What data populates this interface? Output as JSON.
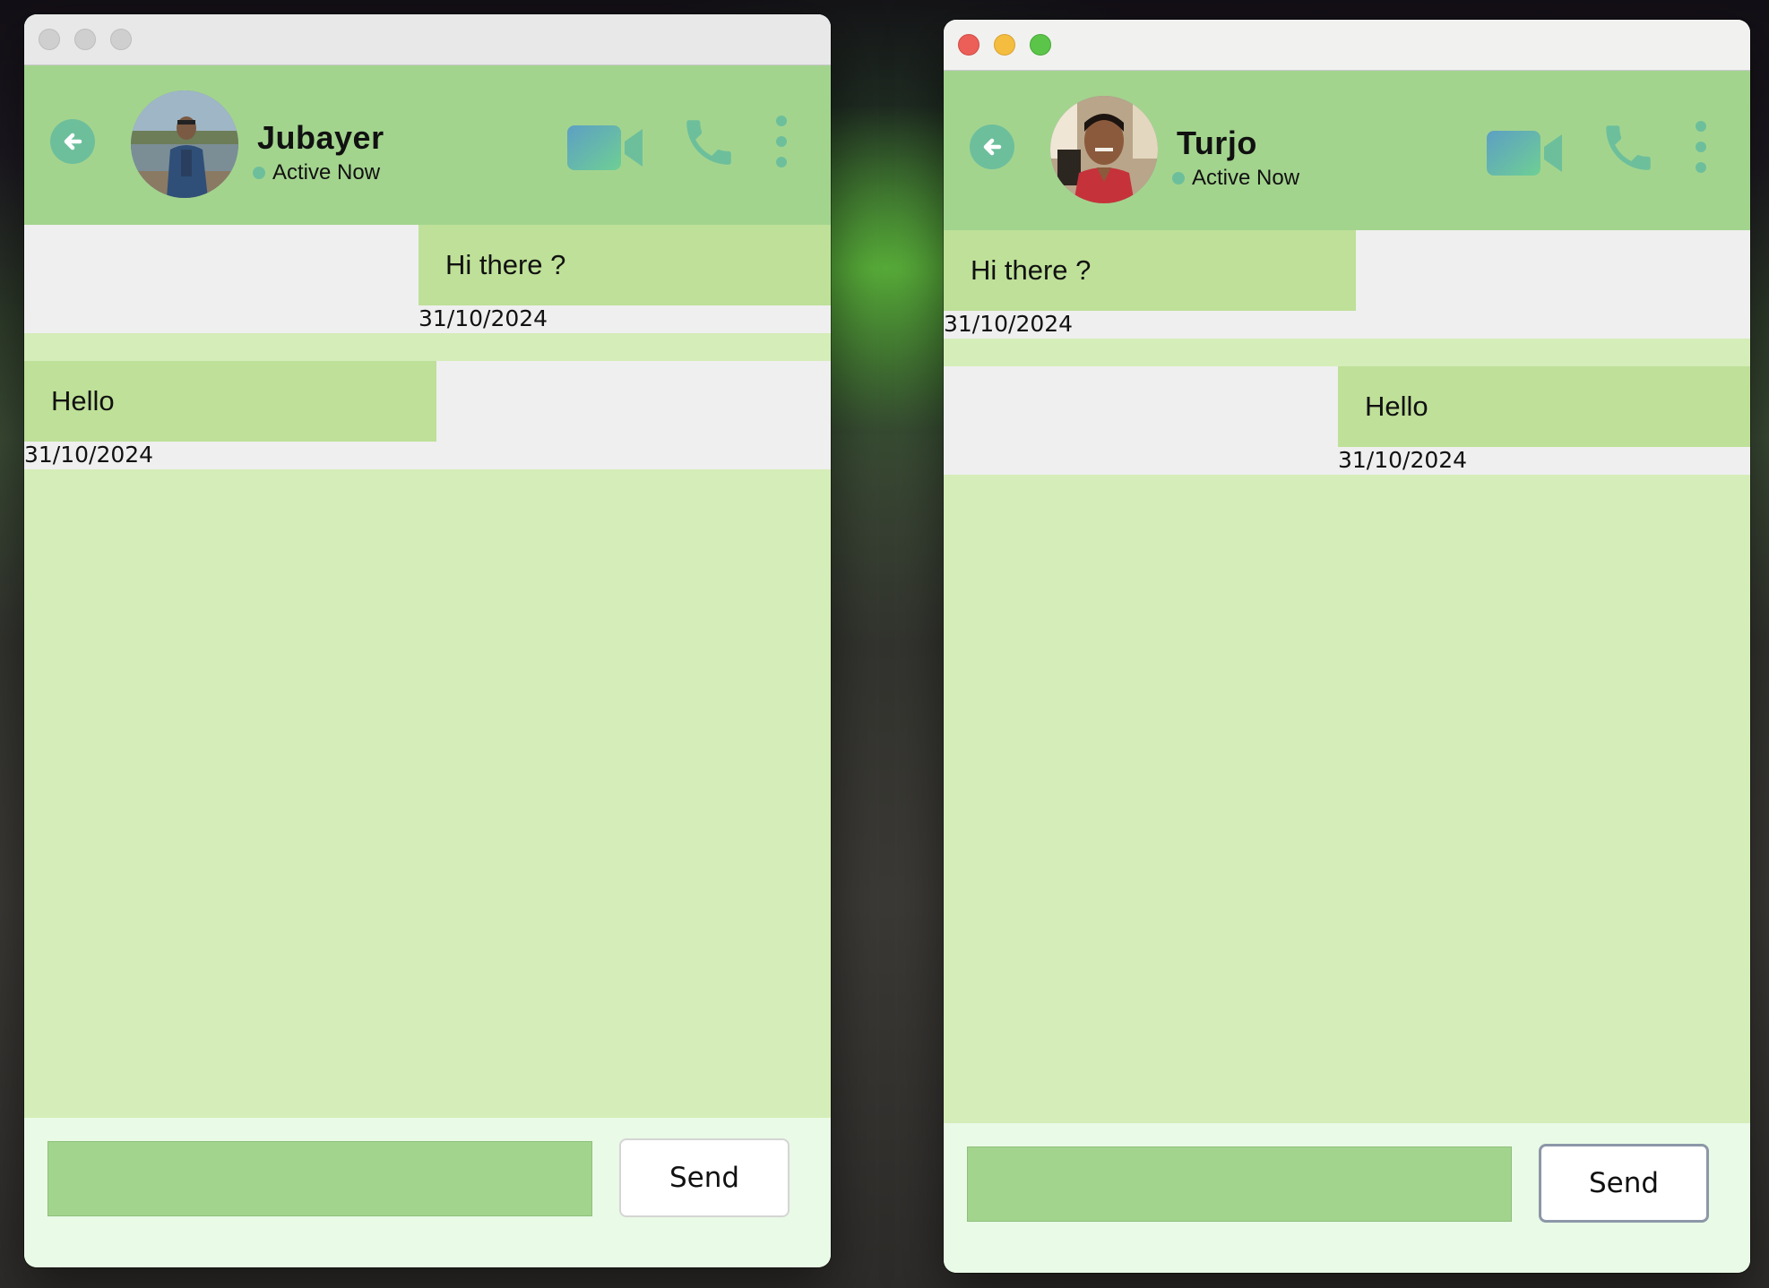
{
  "colors": {
    "header": "#a3d48e",
    "chat_area": "#d5edb8",
    "bubble": "#bee098",
    "message_row": "#efefef",
    "accent_teal": "#6dbf9c"
  },
  "windows": [
    {
      "contact": {
        "name": "Jubayer",
        "status": "Active Now",
        "avatar_icon": "avatar-photo"
      },
      "messages": [
        {
          "text": "Hi there ?",
          "time": "31/10/2024",
          "side": "right"
        },
        {
          "text": "Hello",
          "time": "31/10/2024",
          "side": "left"
        }
      ],
      "composer": {
        "input_value": "",
        "send_label": "Send"
      },
      "icons": [
        "back-arrow-icon",
        "video-camera-icon",
        "phone-icon",
        "more-vertical-icon"
      ]
    },
    {
      "contact": {
        "name": "Turjo",
        "status": "Active Now",
        "avatar_icon": "avatar-photo"
      },
      "messages": [
        {
          "text": "Hi there ?",
          "time": "31/10/2024",
          "side": "left"
        },
        {
          "text": "Hello",
          "time": "31/10/2024",
          "side": "right"
        }
      ],
      "composer": {
        "input_value": "",
        "send_label": "Send"
      },
      "icons": [
        "back-arrow-icon",
        "video-camera-icon",
        "phone-icon",
        "more-vertical-icon"
      ]
    }
  ]
}
